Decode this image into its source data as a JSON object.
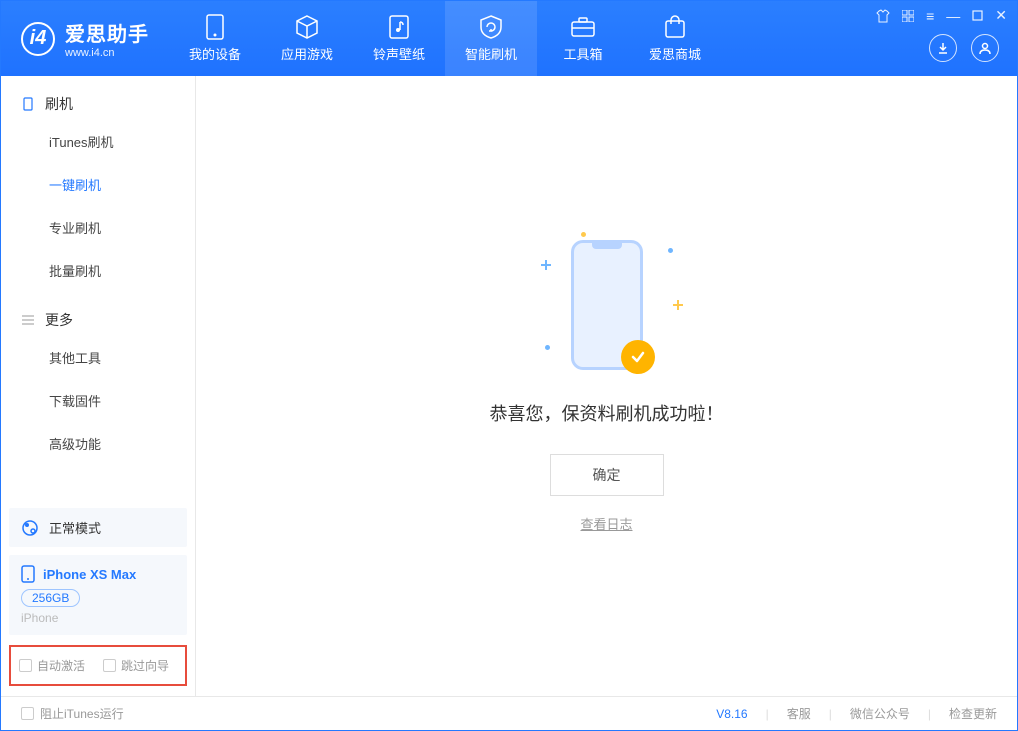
{
  "app": {
    "name": "爱思助手",
    "site": "www.i4.cn"
  },
  "nav": [
    {
      "label": "我的设备",
      "icon": "device"
    },
    {
      "label": "应用游戏",
      "icon": "cube"
    },
    {
      "label": "铃声壁纸",
      "icon": "music"
    },
    {
      "label": "智能刷机",
      "icon": "refresh",
      "active": true
    },
    {
      "label": "工具箱",
      "icon": "toolbox"
    },
    {
      "label": "爱思商城",
      "icon": "bag"
    }
  ],
  "sidebar": {
    "section1": {
      "title": "刷机",
      "items": [
        "iTunes刷机",
        "一键刷机",
        "专业刷机",
        "批量刷机"
      ],
      "active_index": 1
    },
    "section2": {
      "title": "更多",
      "items": [
        "其他工具",
        "下载固件",
        "高级功能"
      ]
    }
  },
  "status": {
    "mode": "正常模式"
  },
  "device": {
    "name": "iPhone XS Max",
    "capacity": "256GB",
    "type": "iPhone"
  },
  "options": {
    "auto_activate": "自动激活",
    "skip_guide": "跳过向导"
  },
  "main": {
    "success_msg": "恭喜您，保资料刷机成功啦！",
    "ok_btn": "确定",
    "log_link": "查看日志"
  },
  "footer": {
    "block_itunes": "阻止iTunes运行",
    "version": "V8.16",
    "links": [
      "客服",
      "微信公众号",
      "检查更新"
    ]
  }
}
